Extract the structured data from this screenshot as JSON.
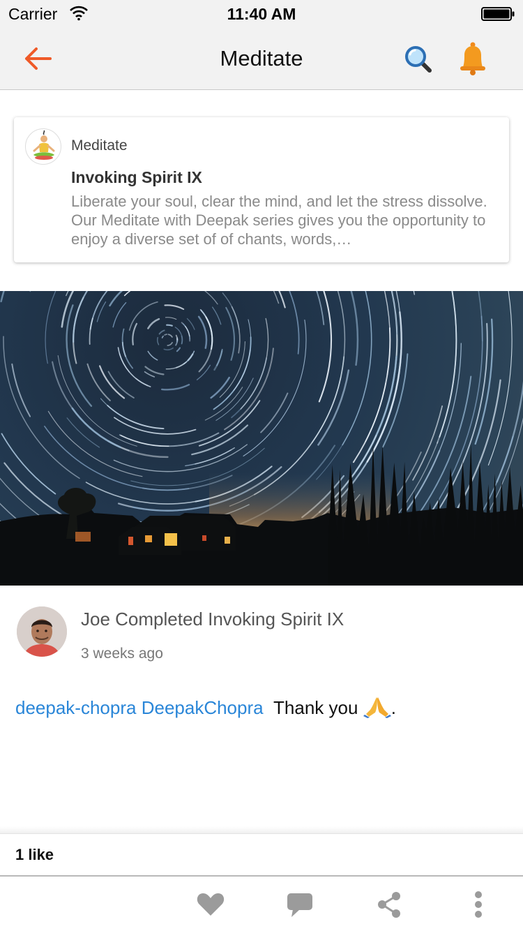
{
  "status_bar": {
    "carrier": "Carrier",
    "time": "11:40 AM"
  },
  "nav": {
    "title": "Meditate",
    "back_icon": "back-arrow-icon",
    "search_icon": "search-icon",
    "bell_icon": "bell-icon",
    "accent_color": "#f05a28"
  },
  "card": {
    "category": "Meditate",
    "title": "Invoking Spirit IX",
    "description": "Liberate your soul, clear the mind, and let the stress dissolve. Our Meditate with Deepak series gives you the opportunity to enjoy a diverse set of of chants, words,…",
    "avatar_icon": "meditating-person-icon"
  },
  "hero": {
    "image": "star-trails-night-sky-photo"
  },
  "post": {
    "headline": "Joe Completed Invoking Spirit IX",
    "time_ago": "3 weeks ago",
    "mention_1": "deepak-chopra",
    "mention_2": "DeepakChopra",
    "message": "Thank you",
    "message_end": ".",
    "emoji": "praying-hands-icon",
    "mention_color": "#2a86d8"
  },
  "likes": {
    "label": "1 like"
  },
  "actions": {
    "icons": [
      "heart-icon",
      "comment-icon",
      "share-icon",
      "more-icon"
    ]
  }
}
